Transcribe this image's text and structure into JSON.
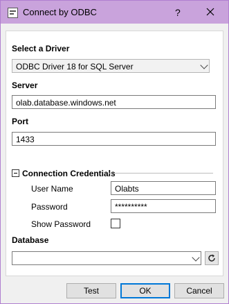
{
  "window": {
    "title": "Connect by ODBC",
    "help_label": "?",
    "close_icon": "close-icon",
    "app_icon": "odbc-window-icon",
    "accent_color": "#c9a3dc"
  },
  "driver": {
    "section_label": "Select a Driver",
    "selected": "ODBC Driver 18 for SQL Server"
  },
  "server": {
    "label": "Server",
    "value": "olab.database.windows.net"
  },
  "port": {
    "label": "Port",
    "value": "1433"
  },
  "credentials": {
    "section_label": "Connection Credentials",
    "expanded": true,
    "user_name_label": "User Name",
    "user_name_value": "Olabts",
    "password_label": "Password",
    "password_value": "**********",
    "show_password_label": "Show Password",
    "show_password_checked": false
  },
  "database": {
    "label": "Database",
    "value": "",
    "refresh_icon": "refresh-icon"
  },
  "buttons": {
    "test": "Test",
    "ok": "OK",
    "cancel": "Cancel"
  }
}
